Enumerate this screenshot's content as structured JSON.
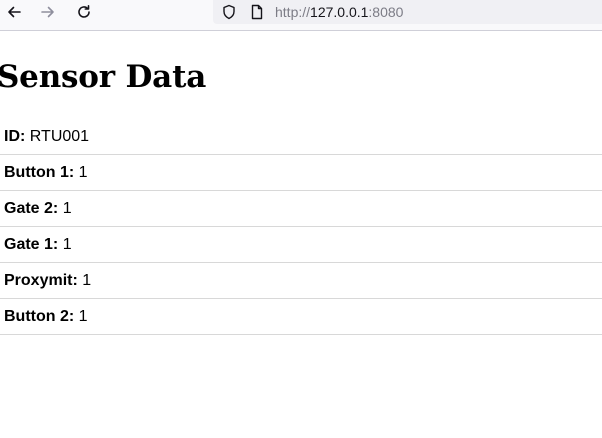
{
  "browser": {
    "url_prefix": "http://",
    "url_host": "127.0.0.1",
    "url_port": ":8080"
  },
  "page": {
    "title": "Sensor Data",
    "rows": [
      {
        "label": "ID:",
        "value": "RTU001"
      },
      {
        "label": "Button 1:",
        "value": "1"
      },
      {
        "label": "Gate 2:",
        "value": "1"
      },
      {
        "label": "Gate 1:",
        "value": "1"
      },
      {
        "label": "Proxymit:",
        "value": "1"
      },
      {
        "label": "Button 2:",
        "value": "1"
      }
    ]
  }
}
